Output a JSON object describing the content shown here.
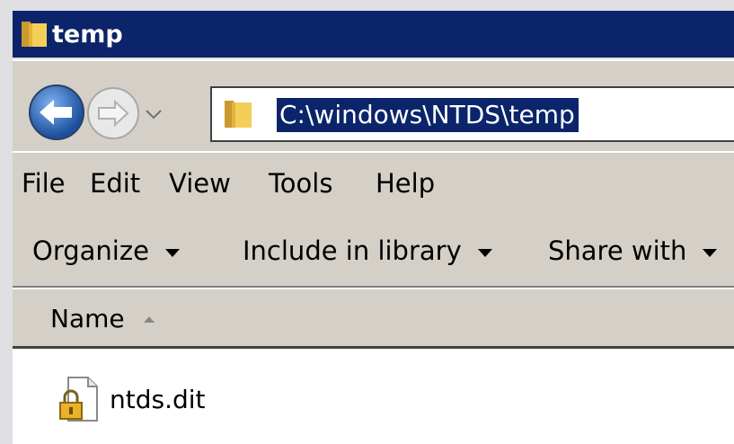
{
  "window": {
    "title": "temp"
  },
  "navigation": {
    "back_icon": "back-arrow-icon",
    "forward_icon": "forward-arrow-icon",
    "history_icon": "chevron-down-icon",
    "address_path": "C:\\windows\\NTDS\\temp"
  },
  "menu": {
    "items": [
      "File",
      "Edit",
      "View",
      "Tools",
      "Help"
    ]
  },
  "toolbar": {
    "organize": "Organize",
    "include_in_library": "Include in library",
    "share_with": "Share with"
  },
  "columns": {
    "name": "Name"
  },
  "files": [
    {
      "name": "ntds.dit",
      "icon": "locked-file-icon"
    }
  ],
  "colors": {
    "titlebar": "#0b246a",
    "chrome": "#d4d0c8",
    "selection": "#0b246a"
  }
}
